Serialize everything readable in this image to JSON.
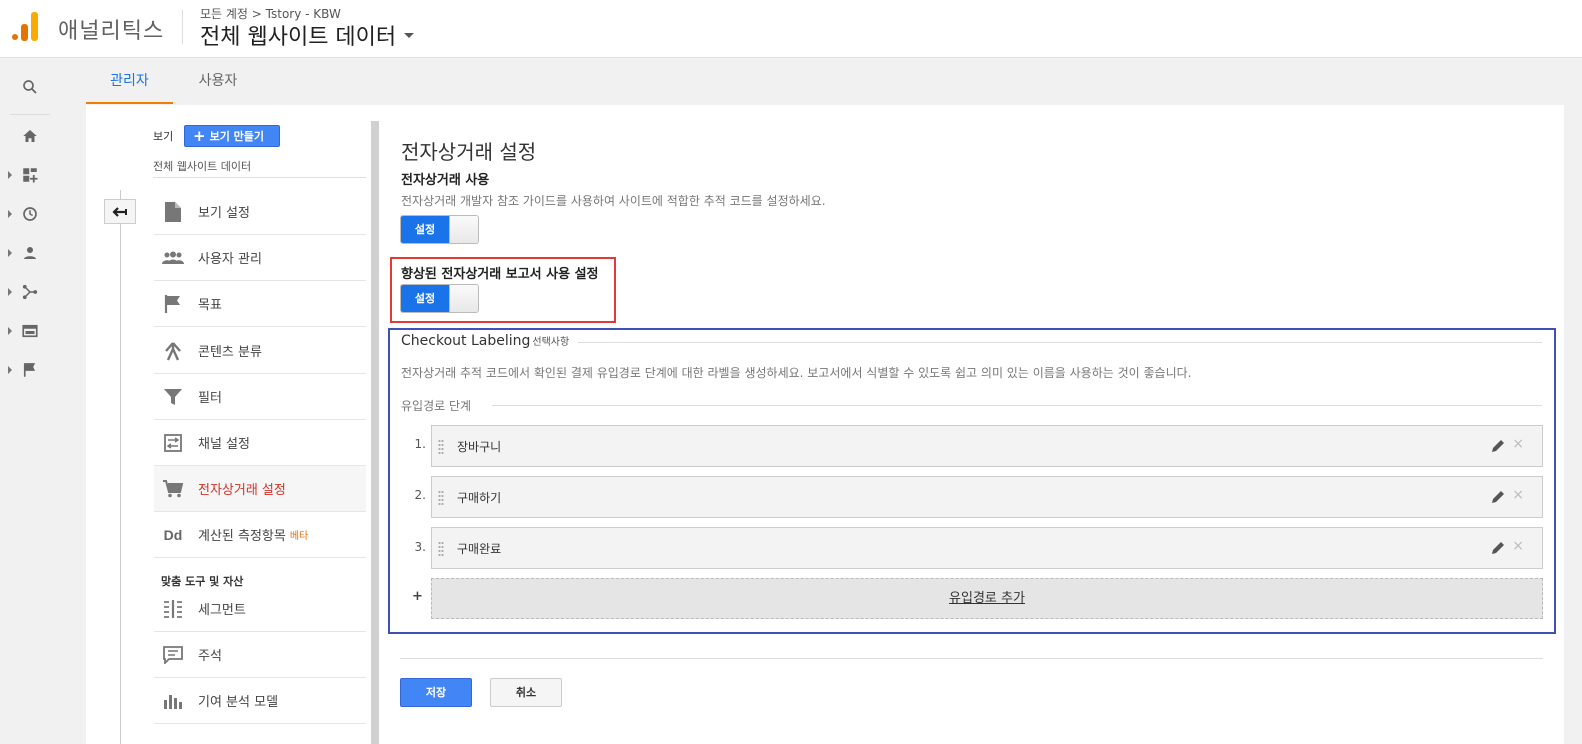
{
  "header": {
    "brand": "애널리틱스",
    "breadcrumb": "모든 계정 > Tstory - KBW",
    "view_title": "전체 웹사이트 데이터"
  },
  "rail": {
    "icons": [
      "search-icon",
      "home-icon",
      "dashboard-icon",
      "clock-icon",
      "person-icon",
      "acquisition-icon",
      "behavior-icon",
      "flag-icon"
    ]
  },
  "tabs": [
    {
      "label": "관리자",
      "active": true
    },
    {
      "label": "사용자",
      "active": false
    }
  ],
  "view_panel": {
    "label": "보기",
    "create_button": "보기 만들기",
    "view_name": "전체 웹사이트 데이터",
    "menu": [
      {
        "label": "보기 설정",
        "icon": "document-icon"
      },
      {
        "label": "사용자 관리",
        "icon": "people-icon"
      },
      {
        "label": "목표",
        "icon": "flag-icon"
      },
      {
        "label": "콘텐츠 분류",
        "icon": "grouping-icon"
      },
      {
        "label": "필터",
        "icon": "filter-icon"
      },
      {
        "label": "채널 설정",
        "icon": "channel-icon"
      },
      {
        "label": "전자상거래 설정",
        "icon": "cart-icon",
        "active": true
      },
      {
        "label": "계산된 측정항목",
        "icon": "dd-icon",
        "badge": "베타"
      }
    ],
    "section_head": "맞춤 도구 및 자산",
    "tools": [
      {
        "label": "세그먼트",
        "icon": "segment-icon"
      },
      {
        "label": "주석",
        "icon": "annotation-icon"
      },
      {
        "label": "기여 분석 모델",
        "icon": "chart-icon"
      }
    ]
  },
  "content": {
    "title": "전자상거래 설정",
    "ecommerce_label": "전자상거래 사용",
    "ecommerce_desc": "전자상거래 개발자 참조 가이드를 사용하여 사이트에 적합한 추적 코드를 설정하세요.",
    "toggle_on_label": "설정",
    "enhanced_label": "향상된 전자상거래 보고서 사용 설정",
    "checkout_title": "Checkout Labeling",
    "checkout_optional": "선택사항",
    "checkout_desc": "전자상거래 추적 코드에서 확인된 결제 유입경로 단계에 대한 라벨을 생성하세요. 보고서에서 식별할 수 있도록 쉽고 의미 있는 이름을 사용하는 것이 좋습니다.",
    "funnel_title": "유입경로 단계",
    "steps": [
      {
        "num": "1.",
        "label": "장바구니"
      },
      {
        "num": "2.",
        "label": "구매하기"
      },
      {
        "num": "3.",
        "label": "구매완료"
      }
    ],
    "add_plus": "+",
    "add_label": "유입경로 추가",
    "save": "저장",
    "cancel": "취소"
  },
  "colors": {
    "accent": "#1a73e8",
    "button_blue": "#4285f4",
    "active_red": "#d93025",
    "tab_underline": "#f57c00",
    "highlight_red": "#e53935",
    "highlight_blue": "#3f51b5"
  }
}
